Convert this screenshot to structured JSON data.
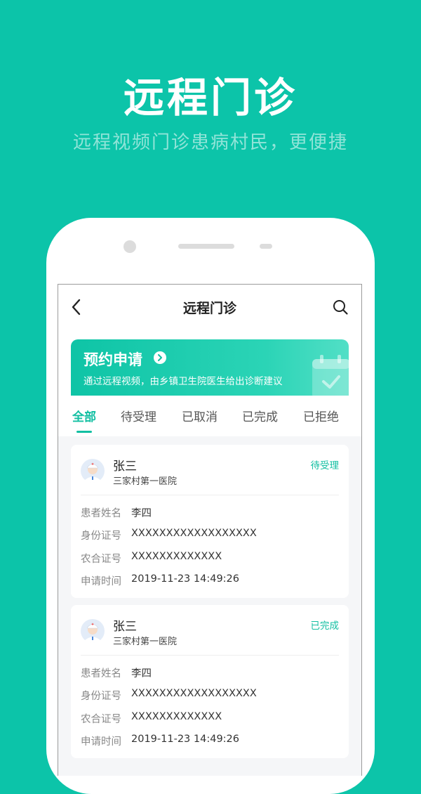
{
  "hero": {
    "title": "远程门诊",
    "subtitle": "远程视频门诊患病村民，更便捷"
  },
  "nav": {
    "back_icon": "chevron-left-icon",
    "title": "远程门诊",
    "search_icon": "search-icon"
  },
  "banner": {
    "title": "预约申请",
    "description": "通过远程视频，由乡镇卫生院医生给出诊断建议",
    "icon": "calendar-check-icon"
  },
  "tabs": [
    {
      "label": "全部",
      "active": true
    },
    {
      "label": "待受理",
      "active": false
    },
    {
      "label": "已取消",
      "active": false
    },
    {
      "label": "已完成",
      "active": false
    },
    {
      "label": "已拒绝",
      "active": false
    }
  ],
  "cards": [
    {
      "doctor": "张三",
      "hospital": "三家村第一医院",
      "status": "待受理",
      "rows": [
        {
          "label": "患者姓名",
          "value": "李四"
        },
        {
          "label": "身份证号",
          "value": "XXXXXXXXXXXXXXXXXX"
        },
        {
          "label": "农合证号",
          "value": "XXXXXXXXXXXXX"
        },
        {
          "label": "申请时间",
          "value": "2019-11-23 14:49:26"
        }
      ]
    },
    {
      "doctor": "张三",
      "hospital": "三家村第一医院",
      "status": "已完成",
      "rows": [
        {
          "label": "患者姓名",
          "value": "李四"
        },
        {
          "label": "身份证号",
          "value": "XXXXXXXXXXXXXXXXXX"
        },
        {
          "label": "农合证号",
          "value": "XXXXXXXXXXXXX"
        },
        {
          "label": "申请时间",
          "value": "2019-11-23 14:49:26"
        }
      ]
    }
  ],
  "colors": {
    "brand": "#0cc4a9",
    "accent": "#12bfa2"
  }
}
